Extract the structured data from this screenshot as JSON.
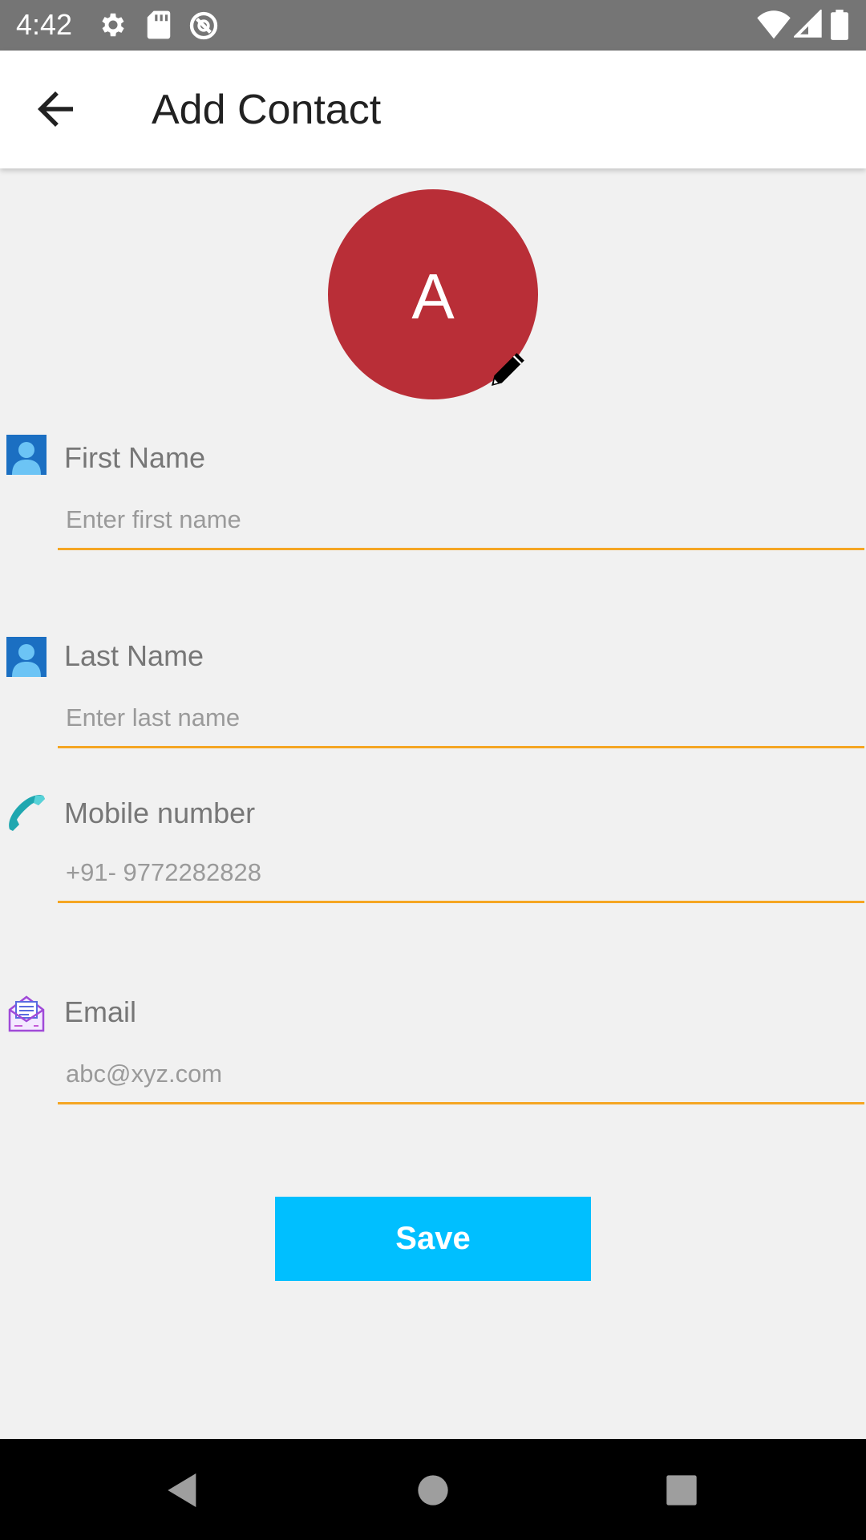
{
  "status_bar": {
    "time": "4:42",
    "icons": [
      "settings-icon",
      "sd-card-icon",
      "sync-icon",
      "wifi-icon",
      "signal-icon",
      "battery-icon"
    ]
  },
  "app_bar": {
    "title": "Add Contact",
    "back_icon": "arrow-back-icon"
  },
  "avatar": {
    "letter": "A",
    "color": "#b92e37",
    "edit_icon": "pencil-icon"
  },
  "form": {
    "first_name": {
      "label": "First Name",
      "placeholder": "Enter first name",
      "icon": "person-icon"
    },
    "last_name": {
      "label": "Last Name",
      "placeholder": "Enter last name",
      "icon": "person-icon"
    },
    "mobile": {
      "label": "Mobile number",
      "placeholder": "+91- 9772282828",
      "icon": "phone-icon"
    },
    "email": {
      "label": "Email",
      "placeholder": "abc@xyz.com",
      "icon": "mail-icon"
    }
  },
  "save_button": {
    "label": "Save",
    "color": "#00bfff"
  },
  "colors": {
    "underline": "#f5a623",
    "background": "#f1f1f1",
    "status_bar": "#757575"
  },
  "nav_bar": {
    "icons": [
      "back-triangle-icon",
      "home-circle-icon",
      "recents-square-icon"
    ]
  }
}
